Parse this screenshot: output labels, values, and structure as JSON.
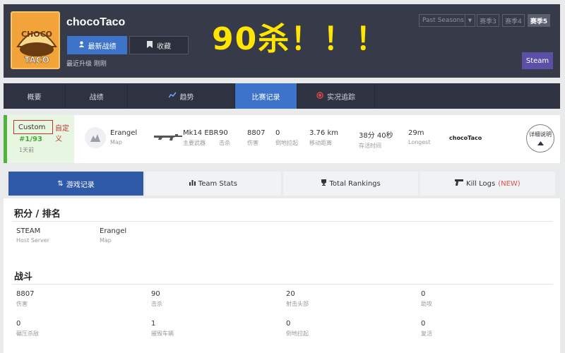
{
  "header": {
    "player_name": "chocoTaco",
    "latest_matches_label": "最新战绩",
    "favorite_label": "收藏",
    "last_update": "最近升级 刚刚",
    "headline": "90杀！！！",
    "season_select": "Past Seasons",
    "seasons": [
      "赛季3",
      "赛季4",
      "赛季5"
    ],
    "steam_label": "Steam",
    "logo_text_top": "CHOCO",
    "logo_text_bottom": "TACO"
  },
  "nav": {
    "items": [
      {
        "label": "概要",
        "icon": ""
      },
      {
        "label": "战绩",
        "icon": ""
      },
      {
        "label": "趋势",
        "icon": "trend-chart-icon"
      },
      {
        "label": "比赛记录",
        "icon": ""
      },
      {
        "label": "实况追踪",
        "icon": "live-record-icon"
      }
    ],
    "active_index": 3
  },
  "match": {
    "mode": "Custom",
    "mode_note": "自定义",
    "rank": "#1/93",
    "ago": "1天前",
    "map_value": "Erangel",
    "map_label": "Map",
    "weapon_value": "Mk14 EBR",
    "weapon_label": "主要武器",
    "kills_value": "90",
    "kills_label": "击杀",
    "damage_value": "8807",
    "damage_label": "伤害",
    "dbno_value": "0",
    "dbno_label": "倒地拉起",
    "distance_value": "3.76 km",
    "distance_label": "移动距离",
    "survival_value": "38分 40秒",
    "survival_label": "存活时间",
    "longest_value": "29m",
    "longest_label": "Longest",
    "player_tag": "chocoTaco",
    "detail_label": "详细说明"
  },
  "subtabs": {
    "items": [
      {
        "label": "游戏记录",
        "icon": "sort-icon"
      },
      {
        "label": "Team Stats",
        "icon": "bar-chart-icon"
      },
      {
        "label": "Total Rankings",
        "icon": "trophy-icon"
      },
      {
        "label": "Kill Logs",
        "icon": "pistol-icon",
        "badge": "(NEW)"
      }
    ],
    "active_index": 0
  },
  "score_section": {
    "title": "积分 / 排名",
    "items": [
      {
        "value": "STEAM",
        "label": "Host Server"
      },
      {
        "value": "Erangel",
        "label": "Map"
      }
    ]
  },
  "combat_section": {
    "title": "战斗",
    "row1": [
      {
        "value": "8807",
        "label": "伤害"
      },
      {
        "value": "90",
        "label": "击杀"
      },
      {
        "value": "20",
        "label": "射击头部"
      },
      {
        "value": "0",
        "label": "助攻"
      }
    ],
    "row2": [
      {
        "value": "0",
        "label": "碾压杀敌"
      },
      {
        "value": "1",
        "label": "摧毁车辆"
      },
      {
        "value": "0",
        "label": "倒地拉起"
      },
      {
        "value": "0",
        "label": "复活"
      }
    ]
  },
  "colors": {
    "header_bg": "#373b49",
    "primary": "#3d74c9",
    "headline": "#ffe500",
    "rank_green": "#4aa83a",
    "steam": "#5b4fa8",
    "alert_red": "#c9302c"
  }
}
